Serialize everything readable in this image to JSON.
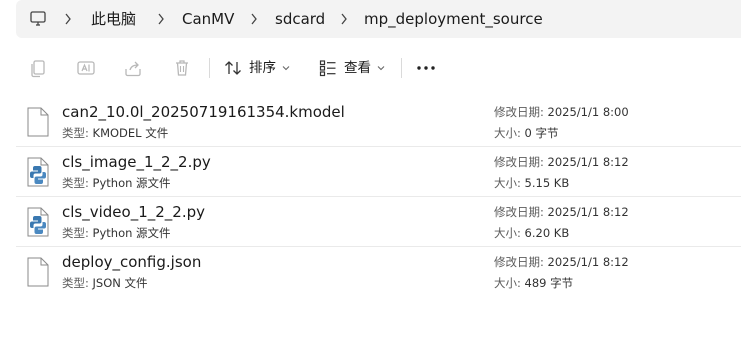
{
  "breadcrumb": {
    "root_icon": "computer-icon",
    "items": [
      "此电脑",
      "CanMV",
      "sdcard",
      "mp_deployment_source"
    ]
  },
  "toolbar": {
    "copy_icon": "copy-icon",
    "rename_icon": "rename-icon",
    "share_icon": "share-icon",
    "delete_icon": "delete-icon",
    "sort_label": "排序",
    "view_label": "查看",
    "more_icon": "more-icon"
  },
  "files": [
    {
      "name": "can2_10.0l_20250719161354.kmodel",
      "type_key": "类型:",
      "type_value": "KMODEL 文件",
      "date_key": "修改日期:",
      "date_value": "2025/1/1 8:00",
      "size_key": "大小:",
      "size_value": "0 字节",
      "icon": "generic-file-icon"
    },
    {
      "name": "cls_image_1_2_2.py",
      "type_key": "类型:",
      "type_value": "Python 源文件",
      "date_key": "修改日期:",
      "date_value": "2025/1/1 8:12",
      "size_key": "大小:",
      "size_value": "5.15 KB",
      "icon": "python-file-icon"
    },
    {
      "name": "cls_video_1_2_2.py",
      "type_key": "类型:",
      "type_value": "Python 源文件",
      "date_key": "修改日期:",
      "date_value": "2025/1/1 8:12",
      "size_key": "大小:",
      "size_value": "6.20 KB",
      "icon": "python-file-icon"
    },
    {
      "name": "deploy_config.json",
      "type_key": "类型:",
      "type_value": "JSON 文件",
      "date_key": "修改日期:",
      "date_value": "2025/1/1 8:12",
      "size_key": "大小:",
      "size_value": "489 字节",
      "icon": "generic-file-icon"
    }
  ],
  "colors": {
    "addressbar_bg": "#f3f3f3",
    "disabled_icon": "#b8b8b8",
    "python_blue": "#3a78b0",
    "python_yellow": "#4a88c0"
  }
}
